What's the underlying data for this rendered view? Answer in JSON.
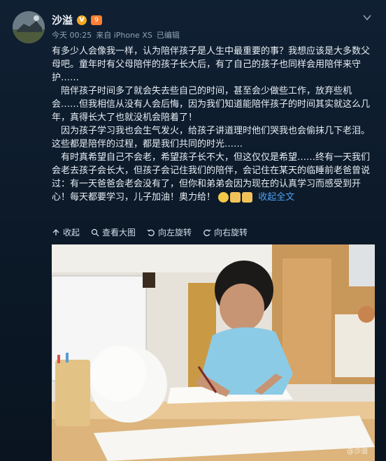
{
  "user": {
    "name": "沙溢",
    "verified_badge": "V",
    "level_badge": "9"
  },
  "meta": {
    "time": "今天 00:25",
    "source": "来自 iPhone XS",
    "edited": "已编辑"
  },
  "post": {
    "paragraphs": [
      "有多少人会像我一样，认为陪伴孩子是人生中最重要的事？我想应该是大多数父母吧。童年时有父母陪伴的孩子长大后，有了自己的孩子也同样会用陪伴来守护……",
      "　陪伴孩子时间多了就会失去些自己的时间，甚至会少做些工作，放弃些机会……但我相信从没有人会后悔，因为我们知道能陪伴孩子的时间其实就这么几年，真得长大了也就没机会陪着了！",
      "　因为孩子学习我也会生气发火，给孩子讲道理时他们哭我也会偷抹几下老泪。这些都是陪伴的过程，都是我们共同的时光……",
      "　有时真希望自己不会老，希望孩子长不大，但这仅仅是希望……终有一天我们会老去孩子会长大，但孩子会记住我们的陪伴，会记住在某天的临睡前老爸曾说过：有一天爸爸会老会没有了，但你和弟弟会因为现在的认真学习而感受到开心！每天都要学习，儿子加油！奥力给！"
    ],
    "collapse_label": "收起全文"
  },
  "toolbar": {
    "collapse": "收起",
    "view_large": "查看大图",
    "rotate_left": "向左旋转",
    "rotate_right": "向右旋转"
  },
  "photo": {
    "watermark": "@沙溢"
  },
  "colors": {
    "link": "#4ea0f0",
    "background": "#0d1a26"
  }
}
